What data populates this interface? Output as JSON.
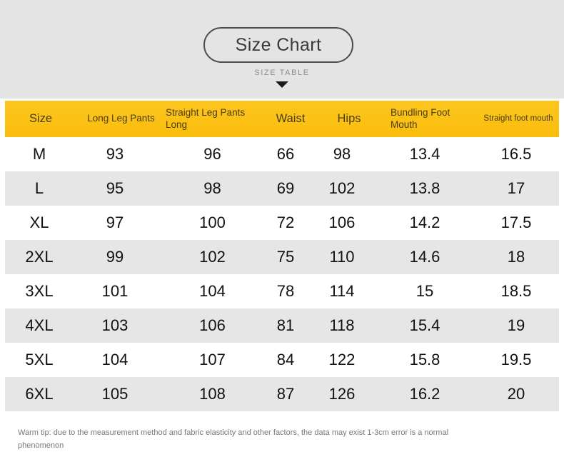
{
  "banner": {
    "title": "Size Chart",
    "subtitle": "SIZE TABLE",
    "arrow_icon": "caret-down-icon",
    "background_color": "#e4e4e4",
    "border_color": "#4c4c4c"
  },
  "table": {
    "header_color": "#fbc016",
    "stripe_color": "#e6e6e6",
    "columns": [
      "Size",
      "Long Leg Pants",
      "Straight Leg Pants Long",
      "Waist",
      "Hips",
      "Bundling Foot Mouth",
      "Straight foot mouth"
    ],
    "rows": [
      {
        "size": "M",
        "long_leg_pants": "93",
        "straight_leg_pants_long": "96",
        "waist": "66",
        "hips": "98",
        "bundling_foot_mouth": "13.4",
        "straight_foot_mouth": "16.5"
      },
      {
        "size": "L",
        "long_leg_pants": "95",
        "straight_leg_pants_long": "98",
        "waist": "69",
        "hips": "102",
        "bundling_foot_mouth": "13.8",
        "straight_foot_mouth": "17"
      },
      {
        "size": "XL",
        "long_leg_pants": "97",
        "straight_leg_pants_long": "100",
        "waist": "72",
        "hips": "106",
        "bundling_foot_mouth": "14.2",
        "straight_foot_mouth": "17.5"
      },
      {
        "size": "2XL",
        "long_leg_pants": "99",
        "straight_leg_pants_long": "102",
        "waist": "75",
        "hips": "110",
        "bundling_foot_mouth": "14.6",
        "straight_foot_mouth": "18"
      },
      {
        "size": "3XL",
        "long_leg_pants": "101",
        "straight_leg_pants_long": "104",
        "waist": "78",
        "hips": "114",
        "bundling_foot_mouth": "15",
        "straight_foot_mouth": "18.5"
      },
      {
        "size": "4XL",
        "long_leg_pants": "103",
        "straight_leg_pants_long": "106",
        "waist": "81",
        "hips": "118",
        "bundling_foot_mouth": "15.4",
        "straight_foot_mouth": "19"
      },
      {
        "size": "5XL",
        "long_leg_pants": "104",
        "straight_leg_pants_long": "107",
        "waist": "84",
        "hips": "122",
        "bundling_foot_mouth": "15.8",
        "straight_foot_mouth": "19.5"
      },
      {
        "size": "6XL",
        "long_leg_pants": "105",
        "straight_leg_pants_long": "108",
        "waist": "87",
        "hips": "126",
        "bundling_foot_mouth": "16.2",
        "straight_foot_mouth": "20"
      }
    ]
  },
  "footer": {
    "tip": "Warm tip: due to the measurement method and fabric elasticity and other factors, the data may exist 1-3cm error is a normal phenomenon"
  }
}
